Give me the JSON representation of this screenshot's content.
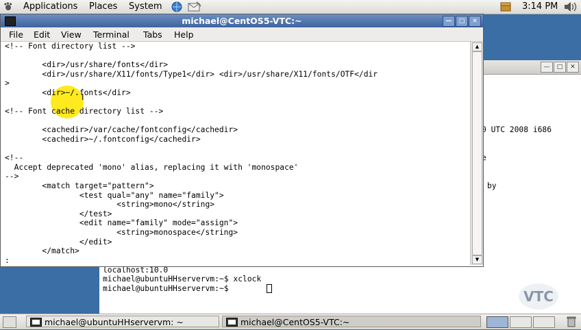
{
  "top_panel": {
    "menus": [
      "Applications",
      "Places",
      "System"
    ],
    "clock": "3:14 PM"
  },
  "terminal": {
    "title": "michael@CentOS5-VTC:~",
    "menus": [
      "File",
      "Edit",
      "View",
      "Terminal",
      "Tabs",
      "Help"
    ],
    "lines": [
      "<!-- Font directory list -->",
      "",
      "        <dir>/usr/share/fonts</dir>",
      "        <dir>/usr/share/X11/fonts/Type1</dir> <dir>/usr/share/X11/fonts/OTF</dir",
      ">",
      "        <dir>~/.fonts</dir>",
      "",
      "<!-- Font cache directory list -->",
      "",
      "        <cachedir>/var/cache/fontconfig</cachedir>",
      "        <cachedir>~/.fontconfig</cachedir>",
      "",
      "<!--",
      "  Accept deprecated 'mono' alias, replacing it with 'monospace'",
      "-->",
      "        <match target=\"pattern\">",
      "                <test qual=\"any\" name=\"family\">",
      "                        <string>mono</string>",
      "                </test>",
      "                <edit name=\"family\" mode=\"assign\">",
      "                        <string>monospace</string>",
      "                </edit>",
      "        </match>",
      ":"
    ]
  },
  "background_terminal": {
    "fragments": [
      "0 UTC 2008 i686",
      "e",
      "by"
    ],
    "lines": [
      "localhost:10.0",
      "michael@ubuntuHHservervm:~$ xclock",
      "michael@ubuntuHHservervm:~$ "
    ]
  },
  "taskbar": {
    "tasks": [
      "michael@ubuntuHHservervm: ~",
      "michael@CentOS5-VTC:~"
    ]
  },
  "watermark": "VTC"
}
